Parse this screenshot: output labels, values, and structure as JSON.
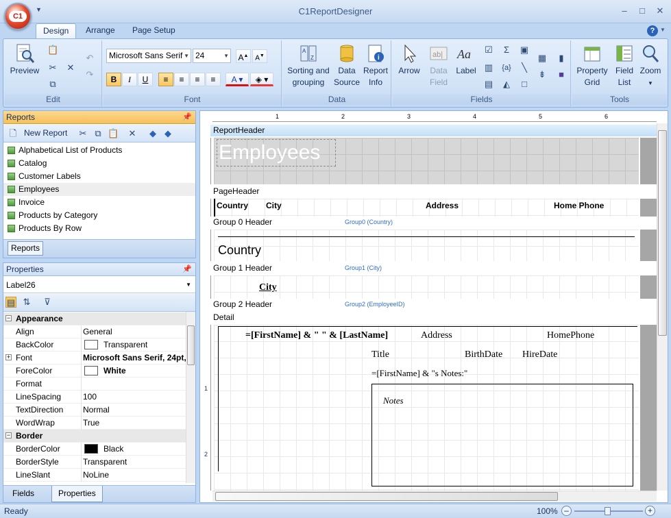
{
  "window": {
    "title": "C1ReportDesigner",
    "orb_label": "C1"
  },
  "ribbon": {
    "tabs": [
      {
        "label": "Design"
      },
      {
        "label": "Arrange"
      },
      {
        "label": "Page Setup"
      }
    ],
    "groups": {
      "edit": {
        "label": "Edit",
        "preview": "Preview"
      },
      "font": {
        "label": "Font",
        "font_name": "Microsoft Sans Serif",
        "font_size": "24"
      },
      "data": {
        "label": "Data",
        "sorting_line1": "Sorting and",
        "sorting_line2": "grouping",
        "source_line1": "Data",
        "source_line2": "Source",
        "info_line1": "Report",
        "info_line2": "Info"
      },
      "fields": {
        "label": "Fields",
        "arrow": "Arrow",
        "datafield_line1": "Data",
        "datafield_line2": "Field",
        "labeltool": "Label"
      },
      "tools": {
        "label": "Tools",
        "grid_line1": "Property",
        "grid_line2": "Grid",
        "fieldlist_line1": "Field",
        "fieldlist_line2": "List",
        "zoom": "Zoom"
      }
    }
  },
  "reports_panel": {
    "title": "Reports",
    "new_report": "New Report",
    "items": [
      {
        "label": "Alphabetical List of Products"
      },
      {
        "label": "Catalog"
      },
      {
        "label": "Customer Labels"
      },
      {
        "label": "Employees"
      },
      {
        "label": "Invoice"
      },
      {
        "label": "Products by Category"
      },
      {
        "label": "Products By Row"
      }
    ],
    "selected": "Employees",
    "tab_label": "Reports"
  },
  "properties_panel": {
    "title": "Properties",
    "selected_object": "Label26",
    "rows": [
      {
        "type": "cat",
        "name": "Appearance"
      },
      {
        "name": "Align",
        "value": "General"
      },
      {
        "name": "BackColor",
        "value": "Transparent",
        "swatch": "#ffffff"
      },
      {
        "name": "Font",
        "value": "Microsoft Sans Serif, 24pt,",
        "bold": true,
        "expand": true
      },
      {
        "name": "ForeColor",
        "value": "White",
        "swatch": "#ffffff",
        "bold": true
      },
      {
        "name": "Format",
        "value": ""
      },
      {
        "name": "LineSpacing",
        "value": "100"
      },
      {
        "name": "TextDirection",
        "value": "Normal"
      },
      {
        "name": "WordWrap",
        "value": "True"
      },
      {
        "type": "cat",
        "name": "Border"
      },
      {
        "name": "BorderColor",
        "value": "Black",
        "swatch": "#000000"
      },
      {
        "name": "BorderStyle",
        "value": "Transparent"
      },
      {
        "name": "LineSlant",
        "value": "NoLine"
      }
    ],
    "tabs": [
      {
        "label": "Fields"
      },
      {
        "label": "Properties"
      }
    ]
  },
  "designer": {
    "ruler_marks": [
      "1",
      "2",
      "3",
      "4",
      "5",
      "6"
    ],
    "vruler_marks": [
      "1",
      "2"
    ],
    "bands": {
      "report_header": {
        "label": "ReportHeader",
        "title_field": "Employees"
      },
      "page_header": {
        "label": "PageHeader",
        "fields": [
          "Country",
          "City",
          "Address",
          "Home Phone"
        ]
      },
      "group0": {
        "label": "Group 0 Header",
        "group": "Group0 (Country)",
        "field": "Country"
      },
      "group1": {
        "label": "Group 1 Header",
        "group": "Group1 (City)",
        "field": "City"
      },
      "group2": {
        "label": "Group 2 Header",
        "group": "Group2 (EmployeeID)"
      },
      "detail": {
        "label": "Detail",
        "name_expr": "=[FirstName] & \" \" & [LastName]",
        "address": "Address",
        "homephone": "HomePhone",
        "title": "Title",
        "birthdate": "BirthDate",
        "hiredate": "HireDate",
        "notes_expr": "=[FirstName] & \"s Notes:\"",
        "notes": "Notes"
      }
    }
  },
  "statusbar": {
    "status": "Ready",
    "zoom": "100%"
  },
  "colors": {
    "accent": "#f6c05a",
    "ribbon": "#d2e3f7",
    "frame": "#bfd6f2"
  }
}
